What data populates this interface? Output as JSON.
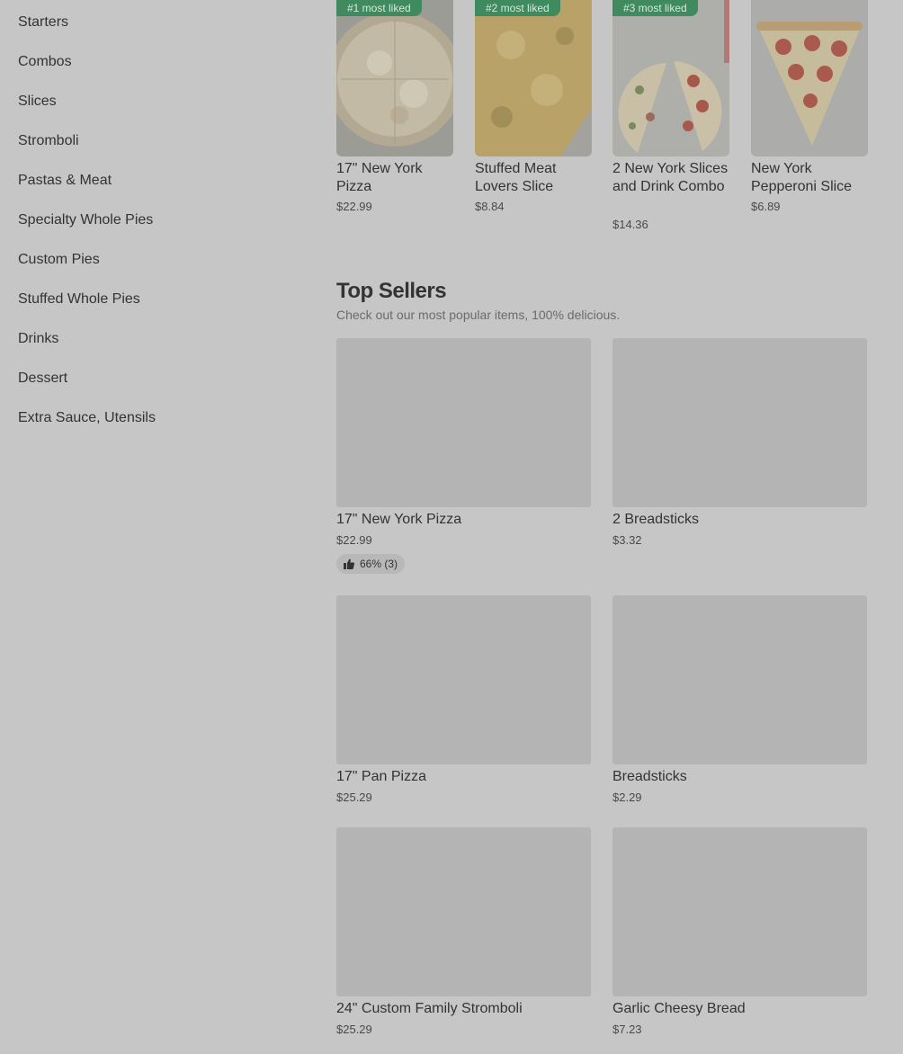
{
  "sidebar": {
    "categories": [
      "Starters",
      "Combos",
      "Slices",
      "Stromboli",
      "Pastas & Meat",
      "Specialty Whole Pies",
      "Custom Pies",
      "Stuffed Whole Pies",
      "Drinks",
      "Dessert",
      "Extra Sauce, Utensils"
    ]
  },
  "most_liked": [
    {
      "badge": "#1 most liked",
      "name": "17\" New York Pizza",
      "price": "$22.99"
    },
    {
      "badge": "#2 most liked",
      "name": "Stuffed Meat Lovers Slice",
      "price": "$8.84"
    },
    {
      "badge": "#3 most liked",
      "name": "2 New York Slices and Drink Combo",
      "price": "$14.36"
    },
    {
      "badge": "",
      "name": "New York Pepperoni Slice",
      "price": "$6.89"
    }
  ],
  "top_sellers": {
    "title": "Top Sellers",
    "subtitle": "Check out our most popular items, 100% delicious.",
    "items": [
      {
        "name": "17\" New York Pizza",
        "price": "$22.99",
        "rating": "66% (3)"
      },
      {
        "name": "2 Breadsticks",
        "price": "$3.32"
      },
      {
        "name": "17\" Pan Pizza",
        "price": "$25.29"
      },
      {
        "name": "Breadsticks",
        "price": "$2.29"
      },
      {
        "name": "24\" Custom Family Stromboli",
        "price": "$25.29"
      },
      {
        "name": "Garlic Cheesy Bread",
        "price": "$7.23"
      }
    ]
  },
  "icons": {
    "thumbs_up": "thumbs-up-icon"
  },
  "colors": {
    "badge_bg": "#3f8a5f",
    "overlay_bg": "#c6c6c6"
  }
}
